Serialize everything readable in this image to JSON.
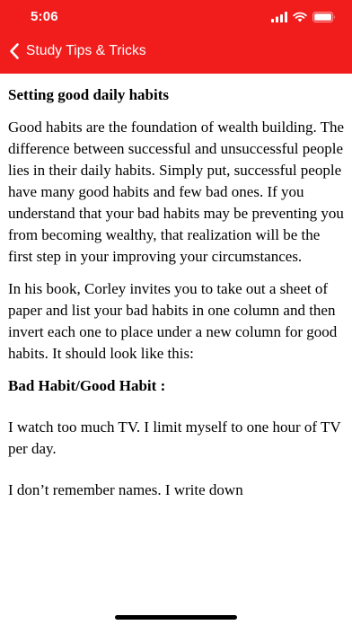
{
  "status_bar": {
    "time": "5:06"
  },
  "nav": {
    "title": "Study Tips & Tricks",
    "back_icon": "chevron-left-icon"
  },
  "colors": {
    "header_bg": "#f11d1d",
    "header_text": "#ffffff",
    "body_text": "#000000"
  },
  "article": {
    "heading": "Setting good daily habits",
    "paragraphs": [
      "Good habits are the foundation of wealth building. The difference between successful and unsuccessful people lies in their daily habits. Simply put, successful people have many good habits and few bad ones. If you understand that your bad habits may be preventing you from becoming wealthy, that realization will be the first step in your improving your circumstances.",
      "In his book, Corley invites you to take out a sheet of paper and list your bad habits in one column and then invert each one to place under a new column for good habits. It should look like this:"
    ],
    "subheading": "Bad Habit/Good Habit :",
    "habit_lines": [
      "I watch too much TV. I limit myself to one hour of TV per day.",
      "I don’t remember names. I write down"
    ]
  }
}
